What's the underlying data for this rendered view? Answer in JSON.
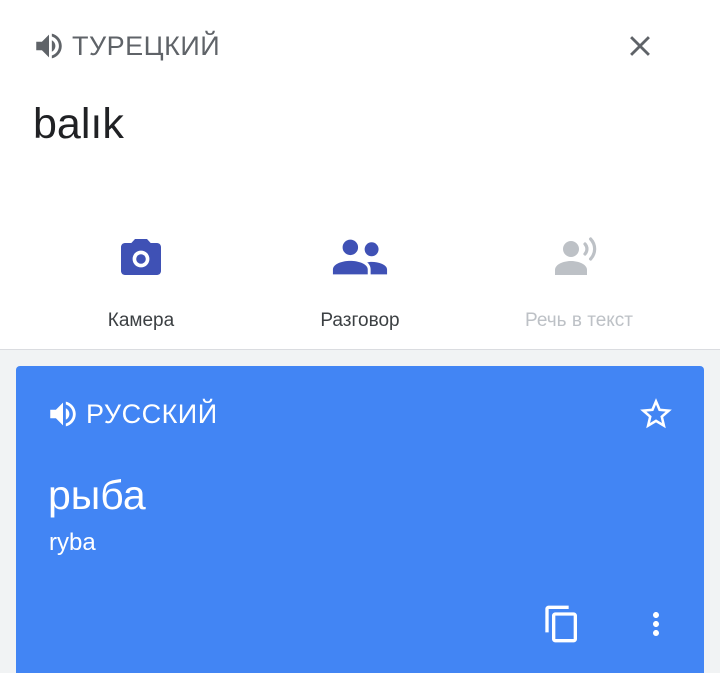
{
  "source": {
    "language": "ТУРЕЦКИЙ",
    "text": "balık",
    "speaker_icon": "volume-icon",
    "close_icon": "close-icon"
  },
  "actions": [
    {
      "label": "Камера",
      "icon": "camera-icon",
      "enabled": true
    },
    {
      "label": "Разговор",
      "icon": "conversation-icon",
      "enabled": true
    },
    {
      "label": "Речь в текст",
      "icon": "speech-to-text-icon",
      "enabled": false
    }
  ],
  "translation": {
    "language": "РУССКИЙ",
    "text": "рыба",
    "transliteration": "ryba",
    "speaker_icon": "volume-icon",
    "star_icon": "star-outline-icon",
    "copy_icon": "copy-icon",
    "more_icon": "more-vert-icon"
  },
  "colors": {
    "accent": "#3f51b5",
    "card": "#4285f4",
    "disabled": "#bdc1c6",
    "text_gray": "#5f6368"
  }
}
